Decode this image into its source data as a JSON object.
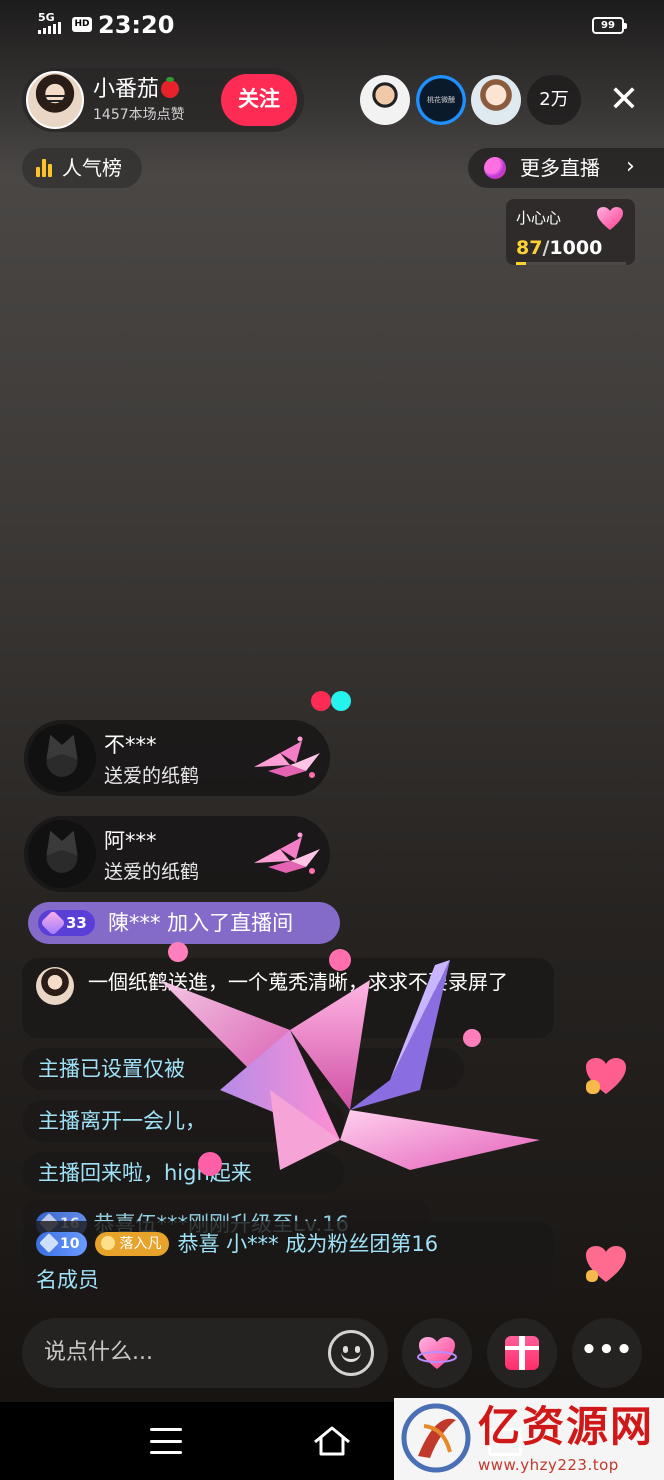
{
  "status_bar": {
    "network": "5G",
    "hd": "HD",
    "time": "23:20",
    "battery": "99"
  },
  "host": {
    "name": "小番茄",
    "likes": "1457本场点赞",
    "follow_label": "关注"
  },
  "viewers": {
    "avatar_2_text": "桃花微醺",
    "count": "2万"
  },
  "close_icon": "close-icon",
  "rank": {
    "label": "人气榜"
  },
  "more_live": {
    "label": "更多直播",
    "chevron": "›"
  },
  "heart_task": {
    "title": "小心心",
    "current": "87",
    "separator": "/",
    "target": "1000",
    "progress_fraction": 0.087
  },
  "gifts": [
    {
      "user": "不***",
      "desc": "送爱的纸鹤"
    },
    {
      "user": "阿***",
      "desc": "送爱的纸鹤"
    }
  ],
  "join": {
    "level": "33",
    "text": "陳*** 加入了直播间"
  },
  "comment": {
    "text": "一個纸鹤送進，一个蒐秃清晰，求求不要录屏了"
  },
  "system_messages": [
    "主播已设置仅被",
    "主播离开一会儿，",
    "主播回来啦，high起来"
  ],
  "upgrade": {
    "level": "16",
    "text": "恭喜伍***刚刚升级至Lv.16"
  },
  "fans": {
    "level": "10",
    "club": "落入凡",
    "line1": "恭喜 小*** 成为粉丝团第16",
    "line2": "名成员"
  },
  "input": {
    "placeholder": "说点什么..."
  },
  "buttons": {
    "more": "•••"
  },
  "watermark": {
    "name": "亿资源网",
    "url": "www.yhzy223.top"
  },
  "colors": {
    "accent": "#fe2c55",
    "cyan": "#25f4ee",
    "system_text": "#9fe2f8",
    "gold": "#ffd233",
    "join_bg": "#9678e6"
  }
}
